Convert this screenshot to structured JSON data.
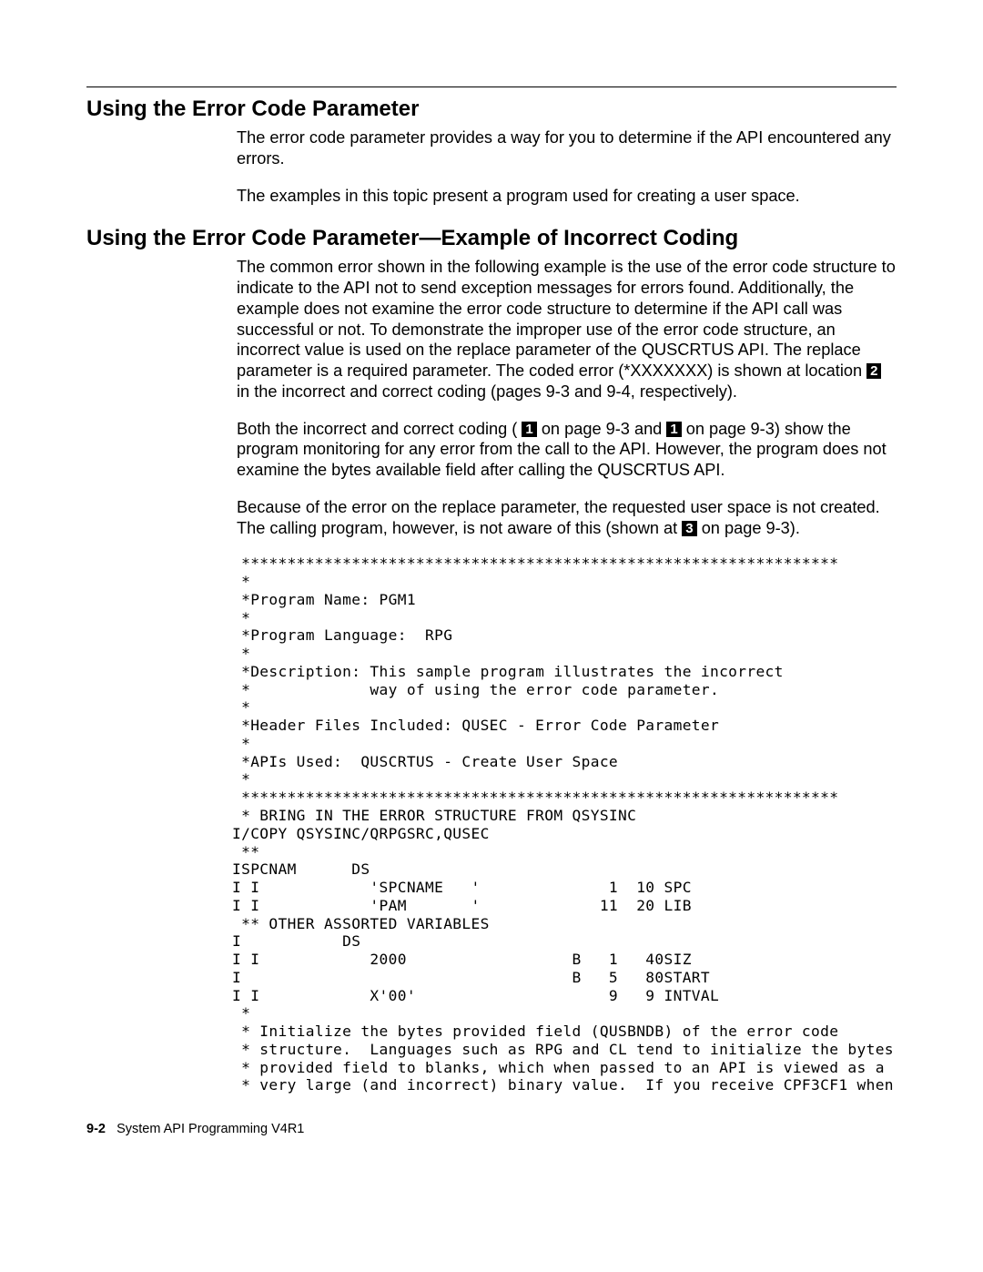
{
  "section1": {
    "heading": "Using the Error Code Parameter",
    "p1": "The error code parameter provides a way for you to determine if the API encountered any errors.",
    "p2": "The examples in this topic present a program used for creating a user space."
  },
  "section2": {
    "heading": "Using the Error Code Parameter—Example of Incorrect Coding",
    "p1a": "The common error shown in the following example is the use of the error code structure to indicate to the API not to send exception messages for errors found. Additionally, the example does not examine the error code structure to determine if the API call was successful or not.  To demonstrate the improper use of the error code structure, an incorrect value is used on the replace parameter of the QUSCRTUS API.  The replace parameter is a required parameter.  The coded error (*XXXXXXX) is shown at location ",
    "ref1": "2",
    "p1b": " in the incorrect and correct coding (pages 9-3 and 9-4, respectively).",
    "p2a": "Both the incorrect and correct coding (",
    "ref2": "1",
    "p2b": " on page 9-3 and ",
    "ref3": "1",
    "p2c": " on page 9-3) show the program monitoring for any error from the call to the API.  However, the program does not examine the bytes available field after calling the QUSCRTUS API.",
    "p3a": "Because of the error on the replace parameter, the requested user space is not created.  The calling program, however, is not aware of this (shown at ",
    "ref4": "3",
    "p3b": " on page 9-3)."
  },
  "code": " *****************************************************************\n *\n *Program Name: PGM1\n *\n *Program Language:  RPG\n *\n *Description: This sample program illustrates the incorrect\n *             way of using the error code parameter.\n *\n *Header Files Included: QUSEC - Error Code Parameter\n *\n *APIs Used:  QUSCRTUS - Create User Space\n *\n *****************************************************************\n * BRING IN THE ERROR STRUCTURE FROM QSYSINC\nI/COPY QSYSINC/QRPGSRC,QUSEC\n **\nISPCNAM      DS\nI I            'SPCNAME   '              1  10 SPC\nI I            'PAM       '             11  20 LIB\n ** OTHER ASSORTED VARIABLES\nI           DS\nI I            2000                  B   1   40SIZ\nI                                    B   5   80START\nI I            X'00'                     9   9 INTVAL\n *\n * Initialize the bytes provided field (QUSBNDB) of the error code\n * structure.  Languages such as RPG and CL tend to initialize the bytes\n * provided field to blanks, which when passed to an API is viewed as a\n * very large (and incorrect) binary value.  If you receive CPF3CF1 when",
  "footer": {
    "pagenum": "9-2",
    "title": "System API Programming V4R1"
  }
}
